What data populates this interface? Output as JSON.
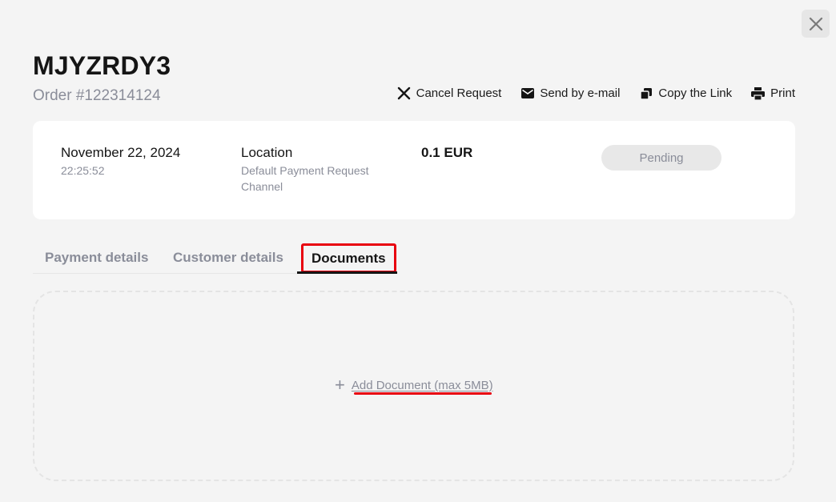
{
  "header": {
    "title": "MJYZRDY3",
    "order_number": "Order #122314124"
  },
  "actions": [
    {
      "label": "Cancel Request",
      "icon": "close-icon"
    },
    {
      "label": "Send by e-mail",
      "icon": "envelope-icon"
    },
    {
      "label": "Copy the Link",
      "icon": "copy-icon"
    },
    {
      "label": "Print",
      "icon": "printer-icon"
    }
  ],
  "summary": {
    "date": "November 22, 2024",
    "time": "22:25:52",
    "location_label": "Location",
    "location_value": "Default Payment Request Channel",
    "amount": "0.1 EUR",
    "status": "Pending"
  },
  "tabs": [
    {
      "label": "Payment details",
      "active": false
    },
    {
      "label": "Customer details",
      "active": false
    },
    {
      "label": "Documents",
      "active": true
    }
  ],
  "dropzone": {
    "icon": "plus-icon",
    "label": "Add Document (max 5MB)"
  },
  "colors": {
    "background": "#f4f4f4",
    "card": "#ffffff",
    "muted_text": "#8a8d99",
    "highlight": "#e8000f",
    "badge_bg": "#e8e8e8"
  }
}
